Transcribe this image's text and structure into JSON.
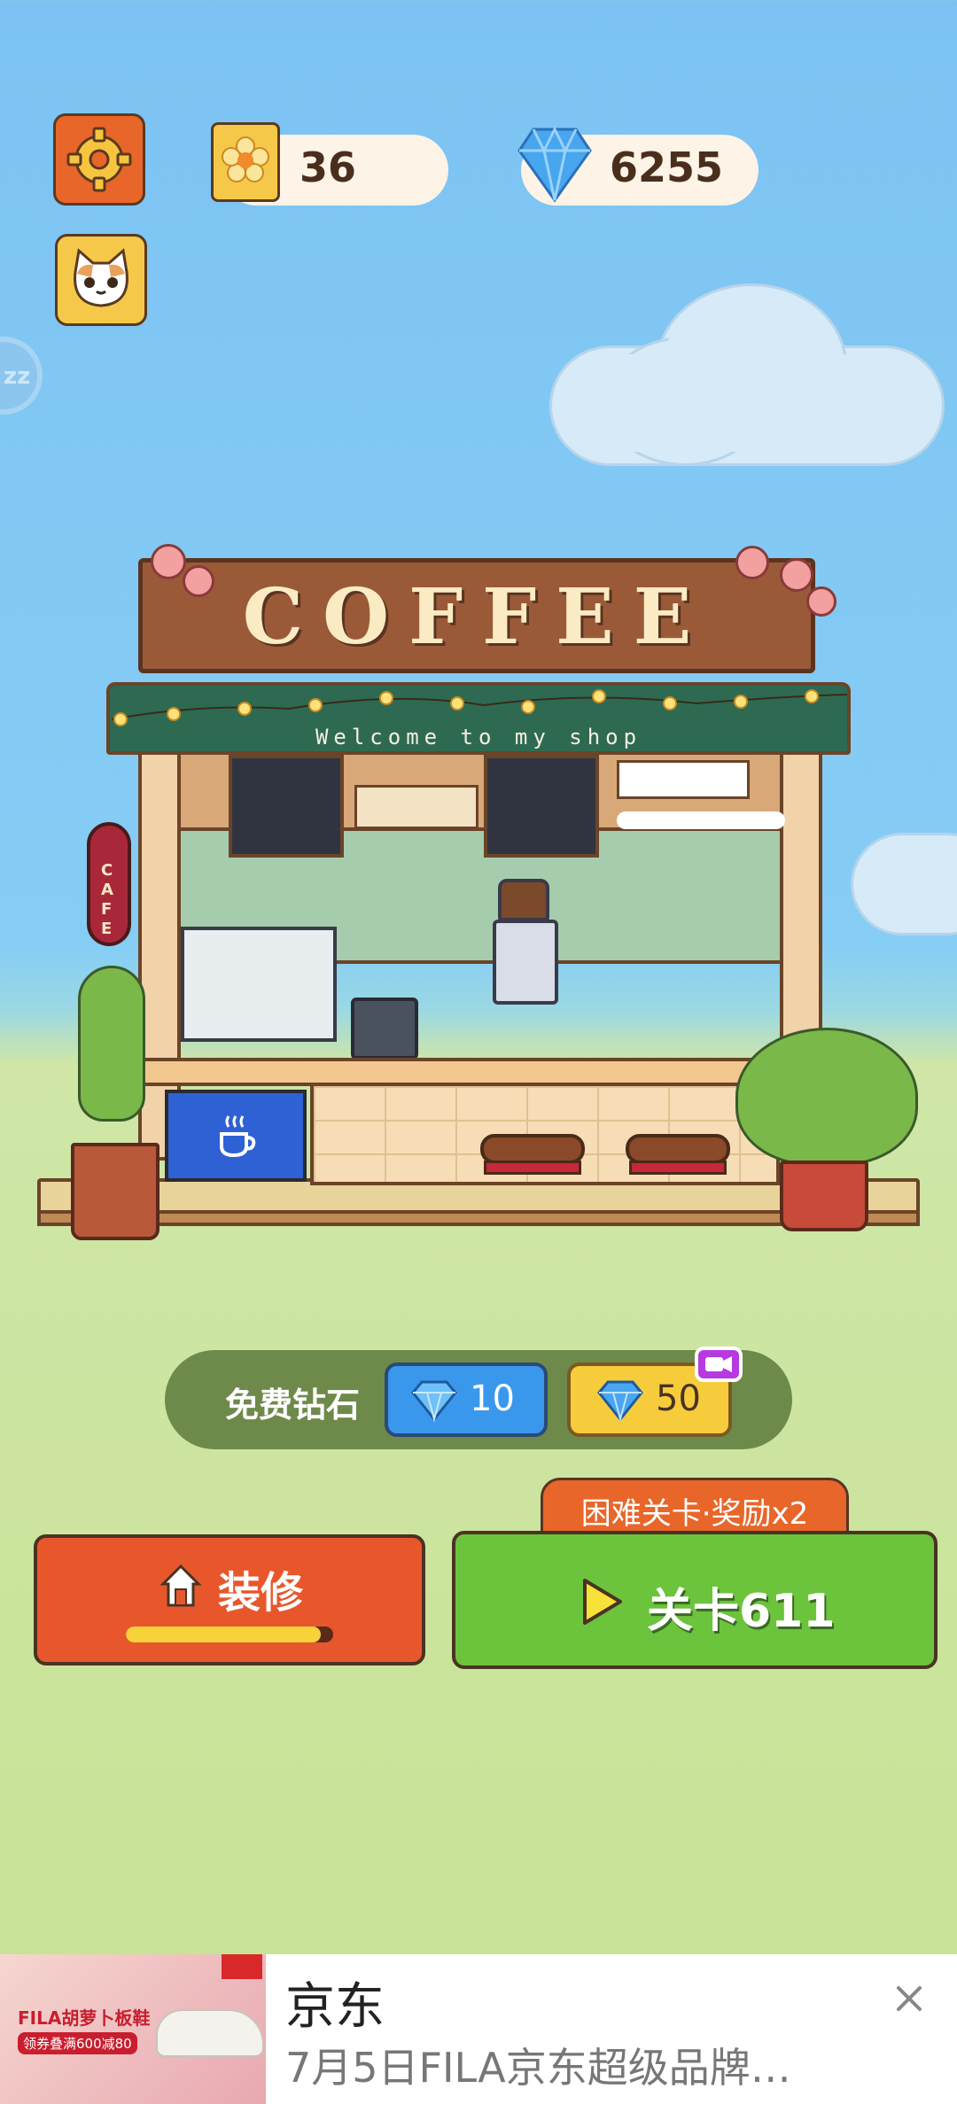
{
  "hud": {
    "flowers": "36",
    "gems": "6255"
  },
  "shop": {
    "sign": "COFFEE",
    "welcome": "Welcome to my shop",
    "side_sign": "CAFE"
  },
  "free_gems": {
    "label": "免费钻石",
    "option_small": "10",
    "option_video": "50"
  },
  "hard_level_banner": "困难关卡·奖励x2",
  "decorate_button": {
    "label": "装修",
    "progress_fraction": 0.94
  },
  "level_button": {
    "label": "关卡611"
  },
  "ad": {
    "title": "京东",
    "subtitle": "7月5日FILA京东超级品牌…",
    "image_text_1": "FILA胡萝卜板鞋",
    "image_text_2": "领券叠满600减80"
  },
  "colors": {
    "sky": "#7cc3f3",
    "grass": "#c7e294",
    "orange_button": "#e8572c",
    "green_button": "#6cc33c",
    "blue_gem_button": "#3a98ec",
    "yellow_gem_button": "#f6cc3c"
  }
}
